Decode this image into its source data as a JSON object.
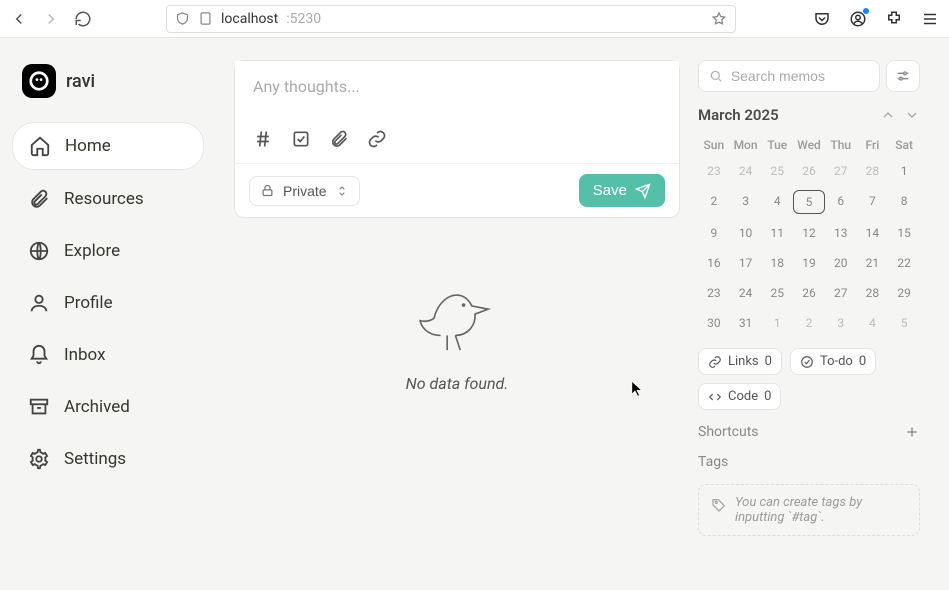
{
  "browser": {
    "url_host": "localhost",
    "url_port": ":5230"
  },
  "user": {
    "name": "ravi"
  },
  "sidebar": {
    "items": [
      {
        "label": "Home"
      },
      {
        "label": "Resources"
      },
      {
        "label": "Explore"
      },
      {
        "label": "Profile"
      },
      {
        "label": "Inbox"
      },
      {
        "label": "Archived"
      },
      {
        "label": "Settings"
      }
    ]
  },
  "composer": {
    "placeholder": "Any thoughts...",
    "visibility": "Private",
    "save_label": "Save"
  },
  "empty": {
    "message": "No data found."
  },
  "search": {
    "placeholder": "Search memos"
  },
  "calendar": {
    "title": "March 2025",
    "dow": [
      "Sun",
      "Mon",
      "Tue",
      "Wed",
      "Thu",
      "Fri",
      "Sat"
    ],
    "days": [
      {
        "d": "23",
        "other": true
      },
      {
        "d": "24",
        "other": true
      },
      {
        "d": "25",
        "other": true
      },
      {
        "d": "26",
        "other": true
      },
      {
        "d": "27",
        "other": true
      },
      {
        "d": "28",
        "other": true
      },
      {
        "d": "1"
      },
      {
        "d": "2"
      },
      {
        "d": "3"
      },
      {
        "d": "4"
      },
      {
        "d": "5",
        "today": true
      },
      {
        "d": "6"
      },
      {
        "d": "7"
      },
      {
        "d": "8"
      },
      {
        "d": "9"
      },
      {
        "d": "10"
      },
      {
        "d": "11"
      },
      {
        "d": "12"
      },
      {
        "d": "13"
      },
      {
        "d": "14"
      },
      {
        "d": "15"
      },
      {
        "d": "16"
      },
      {
        "d": "17"
      },
      {
        "d": "18"
      },
      {
        "d": "19"
      },
      {
        "d": "20"
      },
      {
        "d": "21"
      },
      {
        "d": "22"
      },
      {
        "d": "23"
      },
      {
        "d": "24"
      },
      {
        "d": "25"
      },
      {
        "d": "26"
      },
      {
        "d": "27"
      },
      {
        "d": "28"
      },
      {
        "d": "29"
      },
      {
        "d": "30"
      },
      {
        "d": "31"
      },
      {
        "d": "1",
        "other": true
      },
      {
        "d": "2",
        "other": true
      },
      {
        "d": "3",
        "other": true
      },
      {
        "d": "4",
        "other": true
      },
      {
        "d": "5",
        "other": true
      }
    ]
  },
  "summary": {
    "links": {
      "label": "Links",
      "count": "0"
    },
    "todo": {
      "label": "To-do",
      "count": "0"
    },
    "code": {
      "label": "Code",
      "count": "0"
    }
  },
  "shortcuts": {
    "title": "Shortcuts"
  },
  "tags": {
    "title": "Tags",
    "hint": "You can create tags by inputting `#tag`."
  }
}
